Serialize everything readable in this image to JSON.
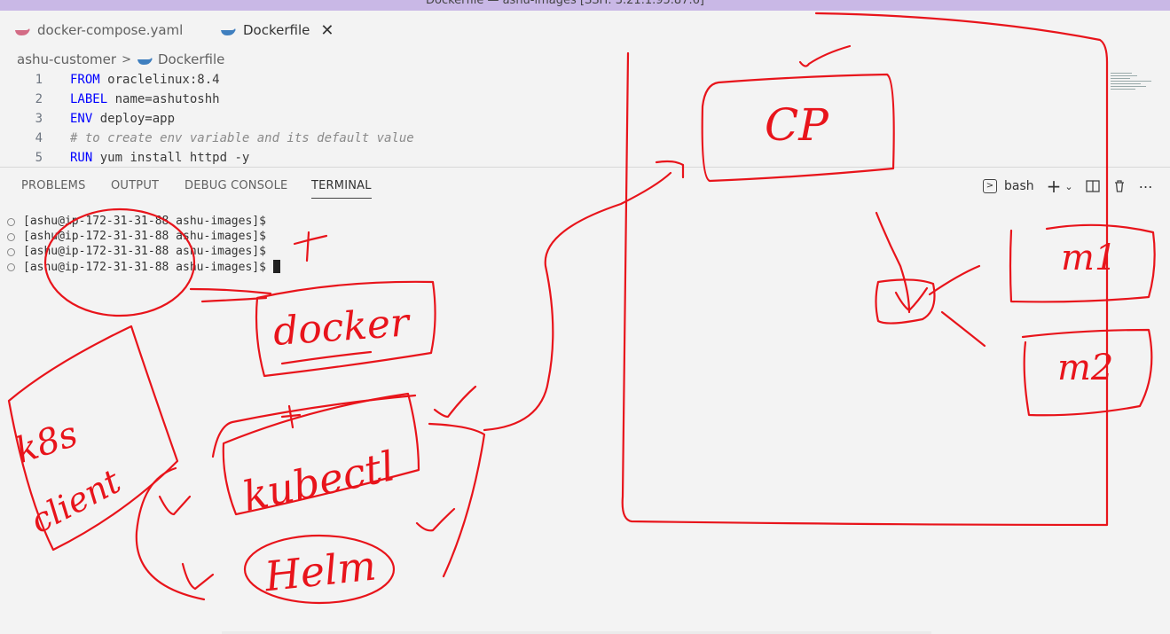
{
  "window": {
    "title": "Dockerfile — ashu-images [SSH: 3.21.1.95.87.6]"
  },
  "tabs": [
    {
      "label": "docker-compose.yaml",
      "icon": "docker-icon",
      "active": false
    },
    {
      "label": "Dockerfile",
      "icon": "docker-icon",
      "active": true,
      "close": "✕"
    }
  ],
  "breadcrumb": {
    "folder": "ashu-customer",
    "file": "Dockerfile"
  },
  "editor": {
    "lines": [
      {
        "num": "1",
        "kw": "FROM",
        "rest": " oraclelinux:8.4"
      },
      {
        "num": "2",
        "kw": "LABEL",
        "rest": " name=ashutoshh"
      },
      {
        "num": "3",
        "kw": "ENV",
        "rest": " deploy=app"
      },
      {
        "num": "4",
        "comment": "# to create env variable and its default value"
      },
      {
        "num": "5",
        "kw": "RUN",
        "rest": " yum install httpd -y"
      }
    ]
  },
  "panel": {
    "tabs": [
      "PROBLEMS",
      "OUTPUT",
      "DEBUG CONSOLE",
      "TERMINAL"
    ],
    "active": "TERMINAL",
    "shell": "bash"
  },
  "terminal": {
    "lines": [
      "[ashu@ip-172-31-31-88 ashu-images]$",
      "[ashu@ip-172-31-31-88 ashu-images]$",
      "[ashu@ip-172-31-31-88 ashu-images]$",
      "[ashu@ip-172-31-31-88 ashu-images]$"
    ]
  },
  "annotations": {
    "color": "#e8141b",
    "docker": "docker",
    "kubectl": "kubectl",
    "helm": "Helm",
    "k8s_client_line1": "k8s",
    "k8s_client_line2": "client",
    "cp": "CP",
    "m1": "m1",
    "m2": "m2"
  }
}
